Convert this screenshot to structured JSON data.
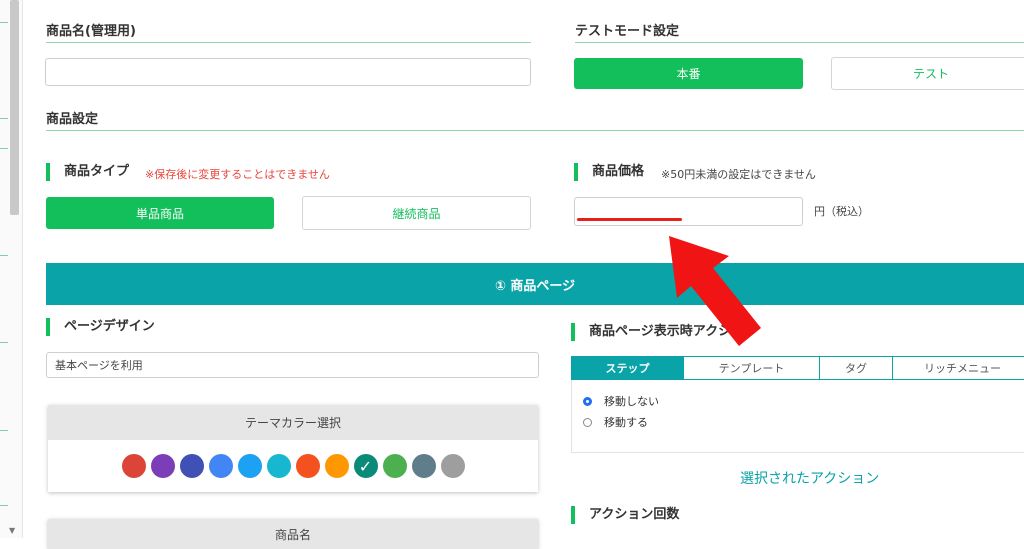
{
  "product_name": {
    "title": "商品名(管理用)",
    "value": ""
  },
  "test_mode": {
    "title": "テストモード設定",
    "live_label": "本番",
    "test_label": "テスト"
  },
  "product_settings": {
    "title": "商品設定"
  },
  "product_type": {
    "title": "商品タイプ",
    "note": "※保存後に変更することはできません",
    "single_label": "単品商品",
    "recurring_label": "継続商品"
  },
  "price": {
    "title": "商品価格",
    "note": "※50円未満の設定はできません",
    "value": "",
    "unit": "円（税込）"
  },
  "product_page": {
    "banner": "① 商品ページ"
  },
  "page_design": {
    "title": "ページデザイン",
    "select_value": "基本ページを利用"
  },
  "theme_color": {
    "header": "テーマカラー選択",
    "swatches": [
      "#dc4437",
      "#7b3eb8",
      "#3f51b5",
      "#4285f4",
      "#1da1f2",
      "#17b8cf",
      "#f4511e",
      "#ff9800",
      "#0a8a78",
      "#4caf50",
      "#607d8b",
      "#9e9e9e"
    ],
    "selected_index": 8,
    "check_glyph": "✓"
  },
  "product_name_card": {
    "header": "商品名"
  },
  "display_action": {
    "title": "商品ページ表示時アクション",
    "tabs": [
      "ステップ",
      "テンプレート",
      "タグ",
      "リッチメニュー"
    ],
    "active_tab": 0,
    "options": [
      "移動しない",
      "移動する"
    ],
    "selected_option": 0,
    "selected_action_link": "選択されたアクション"
  },
  "action_count": {
    "title": "アクション回数"
  },
  "annotation": {
    "arrow_color": "#f01414",
    "line_color": "#e8201a"
  },
  "scroll": {
    "down_arrow": "▼"
  }
}
